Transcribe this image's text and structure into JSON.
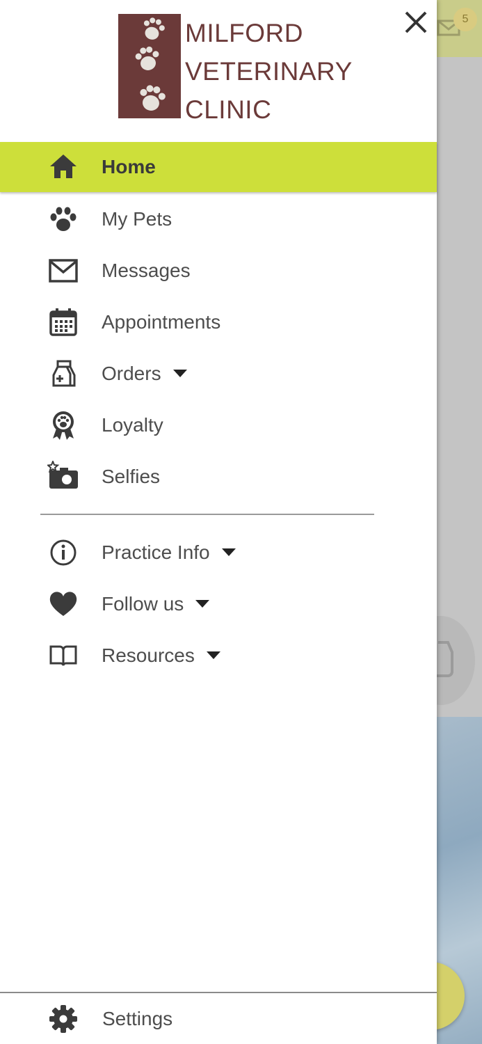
{
  "background": {
    "badge_count": "5"
  },
  "drawer": {
    "logo": {
      "line1": "MILFORD",
      "line2": "VETERINARY",
      "line3": "CLINIC",
      "color": "#6b3a39"
    },
    "accent_color": "#cddf3a",
    "menu": [
      {
        "label": "Home",
        "icon": "home-icon",
        "active": true
      },
      {
        "label": "My Pets",
        "icon": "paw-icon"
      },
      {
        "label": "Messages",
        "icon": "mail-icon"
      },
      {
        "label": "Appointments",
        "icon": "calendar-icon"
      },
      {
        "label": "Orders",
        "icon": "medicine-bag-icon",
        "expandable": true
      },
      {
        "label": "Loyalty",
        "icon": "award-ribbon-icon"
      },
      {
        "label": "Selfies",
        "icon": "camera-star-icon"
      }
    ],
    "menu2": [
      {
        "label": "Practice Info",
        "icon": "info-icon",
        "expandable": true
      },
      {
        "label": "Follow us",
        "icon": "heart-icon",
        "expandable": true
      },
      {
        "label": "Resources",
        "icon": "book-icon",
        "expandable": true
      }
    ],
    "settings": {
      "label": "Settings",
      "icon": "gear-icon"
    }
  }
}
